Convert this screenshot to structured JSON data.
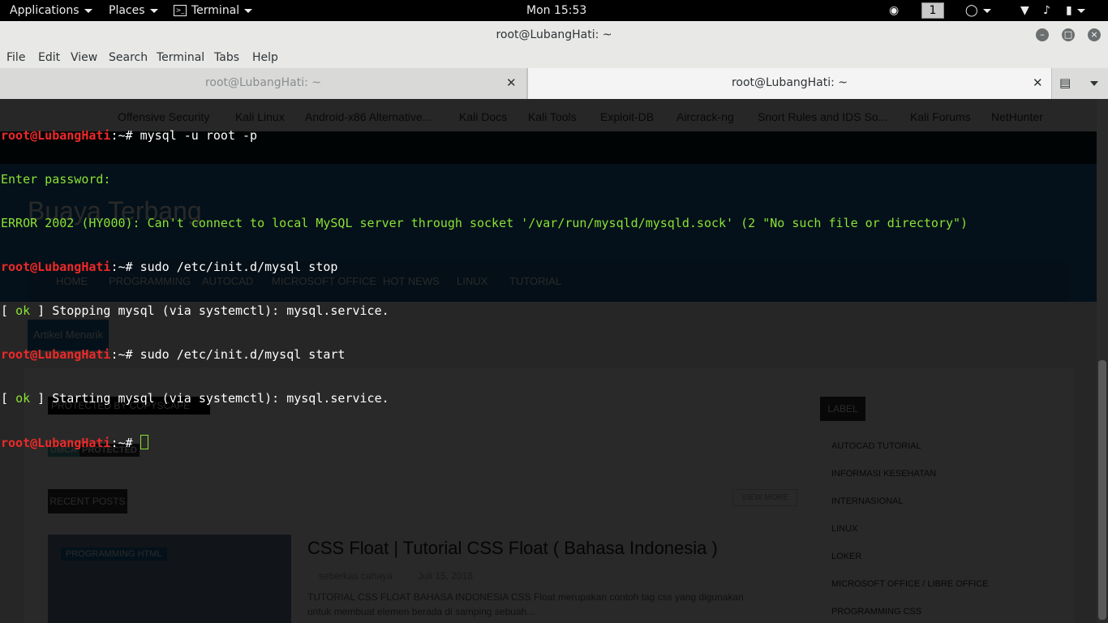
{
  "topbar": {
    "applications": "Applications",
    "places": "Places",
    "app": "Terminal",
    "clock": "Mon 15:53",
    "workspace": "1"
  },
  "window": {
    "title": "root@LubangHati: ~"
  },
  "menu": [
    "File",
    "Edit",
    "View",
    "Search",
    "Terminal",
    "Tabs",
    "Help"
  ],
  "tabs": [
    {
      "label": "root@LubangHati: ~",
      "active": false
    },
    {
      "label": "root@LubangHati: ~",
      "active": true
    }
  ],
  "background_page": {
    "bookmarks": [
      "Offensive Security",
      "Kali Linux",
      "Android-x86 Alternative...",
      "Kali Docs",
      "Kali Tools",
      "Exploit-DB",
      "Aircrack-ng",
      "Snort Rules and IDS So...",
      "Kali Forums",
      "NetHunter"
    ],
    "site_title": "Buaya Terbang",
    "nav": [
      "HOME",
      "PROGRAMMING",
      "AUTOCAD",
      "MICROSOFT OFFICE",
      "HOT NEWS",
      "LINUX",
      "TUTORIAL"
    ],
    "ticker_label": "Artikel Menarik",
    "copyscape": "PROTECTED BY COPYSCAPE",
    "dmca_a": "DMCA",
    "dmca_b": "PROTECTED",
    "recent_posts": "RECENT POSTS",
    "view_more": "VIEW MORE",
    "post_category": "PROGRAMMING HTML",
    "post_title": "CSS Float | Tutorial CSS Float ( Bahasa Indonesia )",
    "post_author": "seberkas cahaya",
    "post_date": "Juli 15, 2018",
    "post_excerpt_1": "TUTORIAL CSS FLOAT BAHASA INDONESIA CSS Float merupakan contoh tag css yang digunakan",
    "post_excerpt_2": "untuk membuat elemen berada di samping  sebuah...",
    "label_heading": "LABEL",
    "labels": [
      "AUTOCAD TUTORIAL",
      "INFORMASI KESEHATAN",
      "INTERNASIONAL",
      "LINUX",
      "LOKER",
      "MICROSOFT OFFICE / LIBRE OFFICE",
      "PROGRAMMING CSS"
    ]
  },
  "terminal": {
    "prompt_user": "root@LubangHati",
    "prompt_sep": ":~#",
    "lines": [
      {
        "kind": "cmd",
        "text": " mysql -u root -p"
      },
      {
        "kind": "out",
        "text": "Enter password: "
      },
      {
        "kind": "out",
        "text": "ERROR 2002 (HY000): Can't connect to local MySQL server through socket '/var/run/mysqld/mysqld.sock' (2 \"No such file or directory\")"
      },
      {
        "kind": "cmd",
        "text": " sudo /etc/init.d/mysql stop"
      },
      {
        "kind": "ok",
        "text": " Stopping mysql (via systemctl): mysql.service."
      },
      {
        "kind": "cmd",
        "text": " sudo /etc/init.d/mysql start"
      },
      {
        "kind": "ok",
        "text": " Starting mysql (via systemctl): mysql.service."
      },
      {
        "kind": "cmd",
        "text": " "
      }
    ],
    "ok_open": "[ ",
    "ok_word": "ok",
    "ok_close": " ]"
  }
}
